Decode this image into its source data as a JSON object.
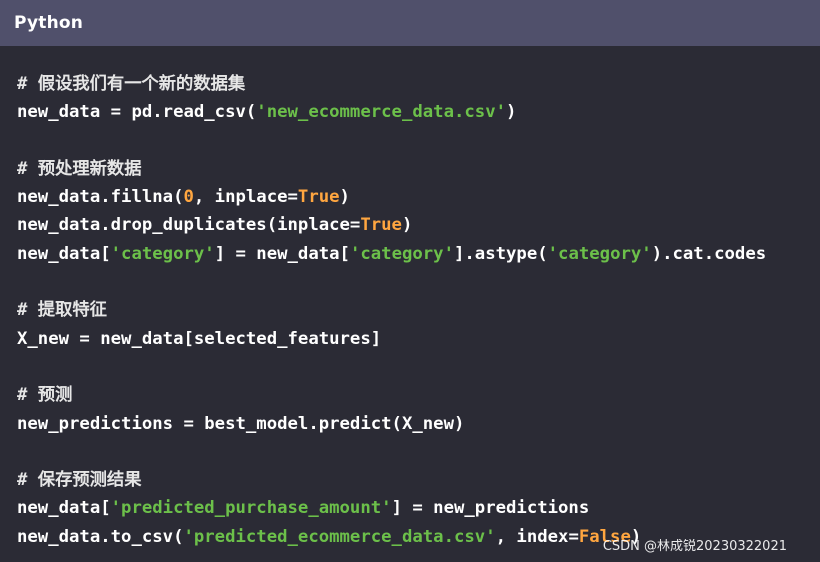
{
  "header": {
    "language": "Python"
  },
  "code": {
    "lines": [
      [
        {
          "t": "comment",
          "v": "# 假设我们有一个新的数据集"
        }
      ],
      [
        {
          "t": "plain",
          "v": "new_data = pd.read_csv("
        },
        {
          "t": "str",
          "v": "'new_ecommerce_data.csv'"
        },
        {
          "t": "plain",
          "v": ")"
        }
      ],
      [],
      [
        {
          "t": "comment",
          "v": "# 预处理新数据"
        }
      ],
      [
        {
          "t": "plain",
          "v": "new_data.fillna("
        },
        {
          "t": "num",
          "v": "0"
        },
        {
          "t": "plain",
          "v": ", inplace="
        },
        {
          "t": "kw",
          "v": "True"
        },
        {
          "t": "plain",
          "v": ")"
        }
      ],
      [
        {
          "t": "plain",
          "v": "new_data.drop_duplicates(inplace="
        },
        {
          "t": "kw",
          "v": "True"
        },
        {
          "t": "plain",
          "v": ")"
        }
      ],
      [
        {
          "t": "plain",
          "v": "new_data["
        },
        {
          "t": "str",
          "v": "'category'"
        },
        {
          "t": "plain",
          "v": "] = new_data["
        },
        {
          "t": "str",
          "v": "'category'"
        },
        {
          "t": "plain",
          "v": "].astype("
        },
        {
          "t": "str",
          "v": "'category'"
        },
        {
          "t": "plain",
          "v": ").cat.codes"
        }
      ],
      [],
      [
        {
          "t": "comment",
          "v": "# 提取特征"
        }
      ],
      [
        {
          "t": "plain",
          "v": "X_new = new_data[selected_features]"
        }
      ],
      [],
      [
        {
          "t": "comment",
          "v": "# 预测"
        }
      ],
      [
        {
          "t": "plain",
          "v": "new_predictions = best_model.predict(X_new)"
        }
      ],
      [],
      [
        {
          "t": "comment",
          "v": "# 保存预测结果"
        }
      ],
      [
        {
          "t": "plain",
          "v": "new_data["
        },
        {
          "t": "str",
          "v": "'predicted_purchase_amount'"
        },
        {
          "t": "plain",
          "v": "] = new_predictions"
        }
      ],
      [
        {
          "t": "plain",
          "v": "new_data.to_csv("
        },
        {
          "t": "str",
          "v": "'predicted_ecommerce_data.csv'"
        },
        {
          "t": "plain",
          "v": ", index="
        },
        {
          "t": "kw",
          "v": "False"
        },
        {
          "t": "plain",
          "v": ")"
        }
      ]
    ]
  },
  "watermark": {
    "text": "CSDN @林成锐20230322021"
  },
  "colors": {
    "background": "#2b2b35",
    "header": "#50506b",
    "string": "#6cc04a",
    "keyword": "#ffa640",
    "number": "#ffa640",
    "text": "#ffffff"
  }
}
